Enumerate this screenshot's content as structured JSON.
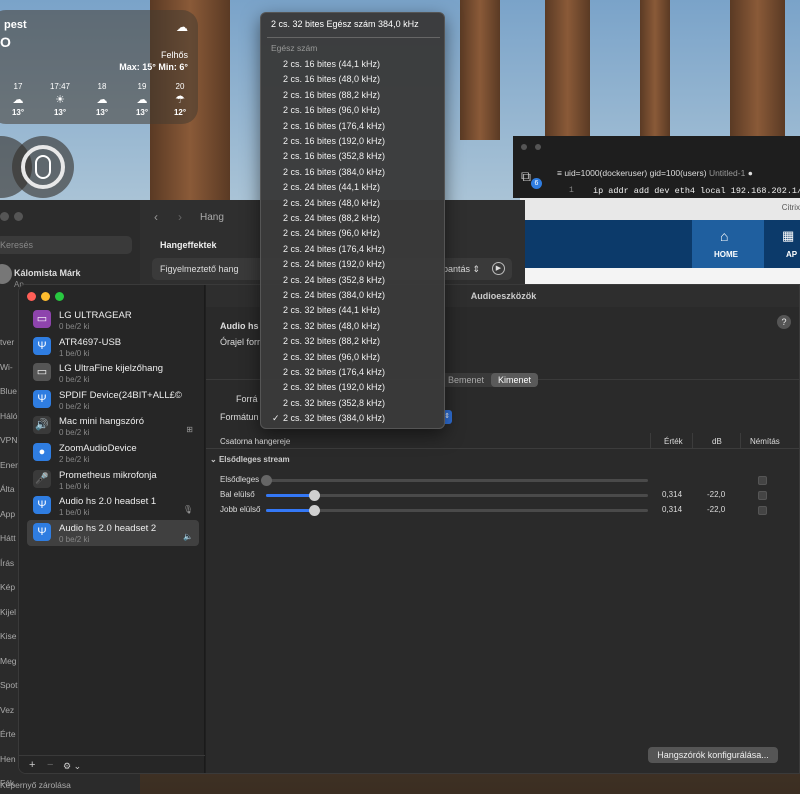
{
  "weather": {
    "city": "pest",
    "temp_glyph": "O",
    "condition": "Felhős",
    "range": "Max: 15° Min: 6°",
    "hours": [
      {
        "time": "17",
        "icon": "cloud-icon",
        "temp": "13°"
      },
      {
        "time": "17:47",
        "icon": "sunset-icon",
        "temp": "13°"
      },
      {
        "time": "18",
        "icon": "cloud-moon-icon",
        "temp": "13°"
      },
      {
        "time": "19",
        "icon": "cloud-moon-icon",
        "temp": "13°"
      },
      {
        "time": "20",
        "icon": "cloud-rain-icon",
        "temp": "12°"
      }
    ]
  },
  "settings_window": {
    "search_placeholder": "Keresés",
    "user_name": "Kálomista Márk",
    "user_sub": "Ap",
    "nav_title": "Hang",
    "section": "Hangeffektek",
    "alert_label": "Figyelmeztető hang",
    "alert_value": "pantás",
    "sidebar_fragments": [
      "tver",
      "Wi-",
      "Blue",
      "Háló",
      "VPN",
      "Ener",
      "Álta",
      "App",
      "Hátt",
      "Írás",
      "Kép",
      "Kijel",
      "Kise",
      "Meg",
      "Spot",
      "Vez",
      "Érte",
      "Hen",
      "Fók",
      "Kép"
    ],
    "bottom_label": "Képernyő zárolása"
  },
  "terminal": {
    "tab_title": "uid=1000(dockeruser) gid=100(users)",
    "tab_suffix": "Untitled-1",
    "line_no": "1",
    "code": "ip addr add dev eth4 local 192.168.202.1/",
    "badge": "6"
  },
  "citrix": {
    "title": "Citrix",
    "home_label": "HOME",
    "ap_label": "AP"
  },
  "audio": {
    "title": "Audioeszközök",
    "help": "?",
    "devices": [
      {
        "name": "LG ULTRAGEAR",
        "sub": "0 be/2 ki",
        "icon": "display-icon",
        "icon_color": "#8e44ad",
        "right": ""
      },
      {
        "name": "ATR4697-USB",
        "sub": "1 be/0 ki",
        "icon": "usb-icon",
        "icon_color": "#2f7de1",
        "right": ""
      },
      {
        "name": "LG UltraFine kijelzőhang",
        "sub": "0 be/2 ki",
        "icon": "monitor-icon",
        "icon_color": "#555555",
        "right": ""
      },
      {
        "name": "SPDIF Device(24BIT+ALL£©",
        "sub": "0 be/2 ki",
        "icon": "usb-icon",
        "icon_color": "#2f7de1",
        "right": ""
      },
      {
        "name": "Mac mini hangszóró",
        "sub": "0 be/2 ki",
        "icon": "speaker-icon",
        "icon_color": "#3a3a3a",
        "right": "⊞"
      },
      {
        "name": "ZoomAudioDevice",
        "sub": "2 be/2 ki",
        "icon": "zoom-icon",
        "icon_color": "#2f7de1",
        "right": ""
      },
      {
        "name": "Prometheus mikrofonja",
        "sub": "1 be/0 ki",
        "icon": "microphone-icon",
        "icon_color": "#3a3a3a",
        "right": ""
      },
      {
        "name": "Audio hs 2.0 headset 1",
        "sub": "1 be/0 ki",
        "icon": "usb-icon",
        "icon_color": "#2f7de1",
        "right": "🎙"
      },
      {
        "name": "Audio hs 2.0 headset 2",
        "sub": "0 be/2 ki",
        "icon": "usb-icon",
        "icon_color": "#2f7de1",
        "right": "🔈"
      }
    ],
    "add": "+",
    "remove": "−",
    "gear": "⚙︎ ⌄",
    "device_title": "Audio hs",
    "clock_label": "Órajel forr",
    "tabs": [
      "Bemenet",
      "Kimenet"
    ],
    "active_tab": "Kimenet",
    "source_label": "Forrá",
    "format_label": "Formátun",
    "columns": [
      "Csatorna hangereje",
      "Érték",
      "dB",
      "Némítás"
    ],
    "stream_header": "Elsődleges stream",
    "channels": [
      {
        "name": "Elsődleges",
        "level": 0.0,
        "value": "",
        "db": ""
      },
      {
        "name": "Bal elülső",
        "level": 0.314,
        "value": "0,314",
        "db": "-22,0"
      },
      {
        "name": "Jobb elülső",
        "level": 0.314,
        "value": "0,314",
        "db": "-22,0"
      }
    ],
    "configure_button": "Hangszórók konfigurálása..."
  },
  "format_menu": {
    "current": "2 cs. 32 bites Egész szám 384,0 kHz",
    "header": "Egész szám",
    "selected_index": 23,
    "checkmark": "✓",
    "items": [
      "2 cs. 16 bites (44,1 kHz)",
      "2 cs. 16 bites (48,0 kHz)",
      "2 cs. 16 bites (88,2 kHz)",
      "2 cs. 16 bites (96,0 kHz)",
      "2 cs. 16 bites (176,4 kHz)",
      "2 cs. 16 bites (192,0 kHz)",
      "2 cs. 16 bites (352,8 kHz)",
      "2 cs. 16 bites (384,0 kHz)",
      "2 cs. 24 bites (44,1 kHz)",
      "2 cs. 24 bites (48,0 kHz)",
      "2 cs. 24 bites (88,2 kHz)",
      "2 cs. 24 bites (96,0 kHz)",
      "2 cs. 24 bites (176,4 kHz)",
      "2 cs. 24 bites (192,0 kHz)",
      "2 cs. 24 bites (352,8 kHz)",
      "2 cs. 24 bites (384,0 kHz)",
      "2 cs. 32 bites (44,1 kHz)",
      "2 cs. 32 bites (48,0 kHz)",
      "2 cs. 32 bites (88,2 kHz)",
      "2 cs. 32 bites (96,0 kHz)",
      "2 cs. 32 bites (176,4 kHz)",
      "2 cs. 32 bites (192,0 kHz)",
      "2 cs. 32 bites (352,8 kHz)",
      "2 cs. 32 bites (384,0 kHz)"
    ]
  }
}
